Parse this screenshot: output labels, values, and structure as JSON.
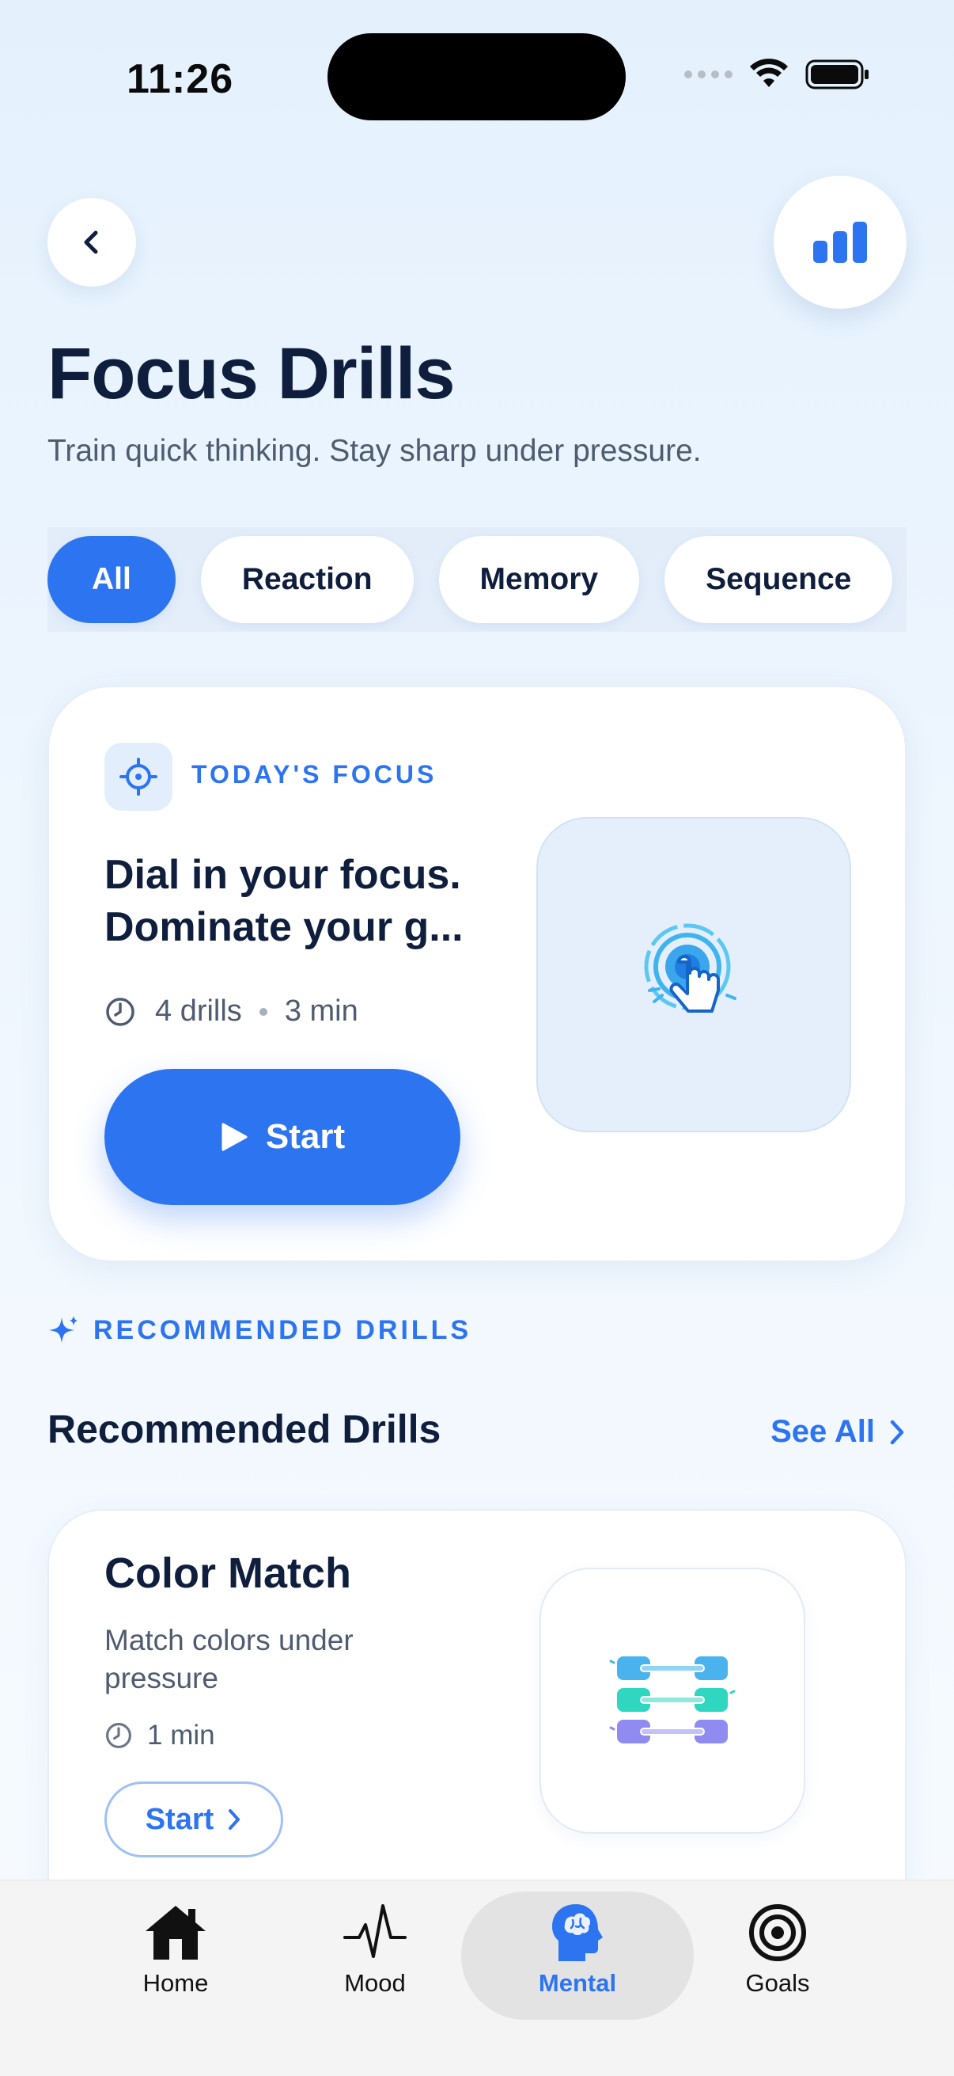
{
  "status": {
    "time": "11:26"
  },
  "header": {
    "title": "Focus Drills",
    "subtitle": "Train quick thinking. Stay sharp under pressure."
  },
  "filters": [
    {
      "label": "All",
      "active": true
    },
    {
      "label": "Reaction",
      "active": false
    },
    {
      "label": "Memory",
      "active": false
    },
    {
      "label": "Sequence",
      "active": false
    }
  ],
  "focus_card": {
    "label": "TODAY'S FOCUS",
    "headline_line1": "Dial in your focus.",
    "headline_line2": "Dominate your g...",
    "drills": "4 drills",
    "duration": "3 min",
    "start_label": "Start"
  },
  "recommended": {
    "section_label": "RECOMMENDED DRILLS",
    "title": "Recommended Drills",
    "see_all": "See All"
  },
  "drill_card": {
    "title": "Color Match",
    "description": "Match colors under pressure",
    "duration": "1 min",
    "start_label": "Start"
  },
  "tabbar": {
    "home": "Home",
    "mood": "Mood",
    "mental": "Mental",
    "goals": "Goals"
  },
  "colors": {
    "accent": "#2d74f0",
    "text": "#0f1e3d",
    "muted": "#4f5b70"
  }
}
